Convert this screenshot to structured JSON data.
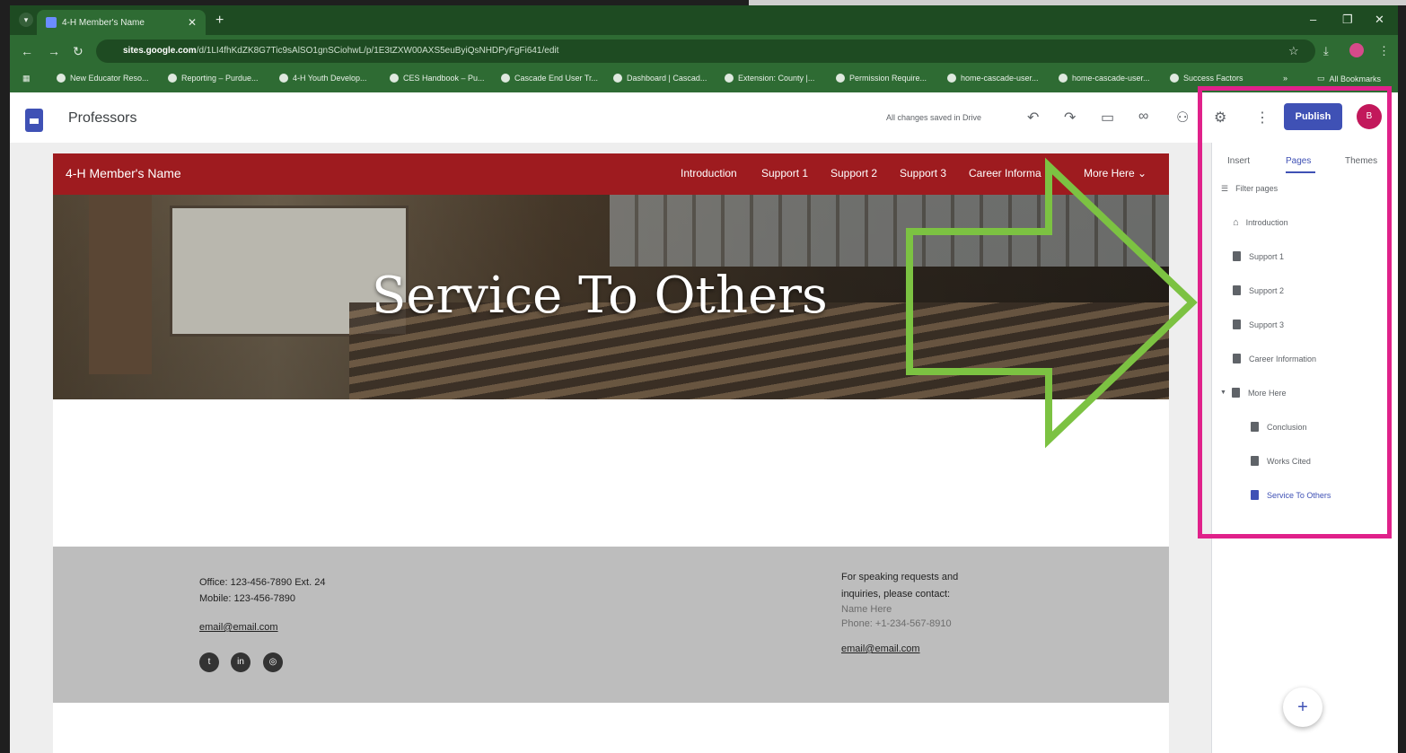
{
  "browser": {
    "tab_title": "4-H Member's Name",
    "tab_close": "✕",
    "new_tab": "+",
    "url_host": "sites.google.com",
    "url_path": "/d/1LI4fhKdZK8G7Tic9sAlSO1gnSCiohwL/p/1E3tZXW00AXS5euByiQsNHDPyFgFi641/edit",
    "window_controls": [
      "–",
      "❐",
      "✕"
    ],
    "bookmarks": [
      "New Educator Reso...",
      "Reporting – Purdue...",
      "4-H Youth Develop...",
      "CES Handbook – Pu...",
      "Cascade End User Tr...",
      "Dashboard | Cascad...",
      "Extension: County |...",
      "Permission Require...",
      "home-cascade-user...",
      "home-cascade-user...",
      "Success Factors"
    ],
    "bookmarks_more": "»",
    "all_bookmarks": "All Bookmarks"
  },
  "sites": {
    "site_name": "Professors",
    "save_status": "All changes saved in Drive",
    "publish_label": "Publish",
    "avatar_initial": "B"
  },
  "page": {
    "site_title": "4-H Member's Name",
    "nav": [
      "Introduction",
      "Support 1",
      "Support 2",
      "Support 3",
      "Career Informa",
      "More Here ⌄"
    ],
    "hero_title": "Service To Others",
    "footer_left": {
      "office": "Office: 123-456-7890 Ext. 24",
      "mobile": "Mobile: 123-456-7890",
      "email": "email@email.com"
    },
    "footer_right": {
      "line1": "For speaking requests and",
      "line2": "inquiries, please contact:",
      "name": "Name Here",
      "phone": "Phone: +1-234-567-8910",
      "email": "email@email.com"
    }
  },
  "panel": {
    "tabs": [
      "Insert",
      "Pages",
      "Themes"
    ],
    "active_tab": "Pages",
    "filter_placeholder": "Filter pages",
    "pages": [
      {
        "label": "Introduction",
        "icon": "home-icon"
      },
      {
        "label": "Support 1",
        "icon": "page-icon"
      },
      {
        "label": "Support 2",
        "icon": "page-icon"
      },
      {
        "label": "Support 3",
        "icon": "page-icon"
      },
      {
        "label": "Career Information",
        "icon": "page-icon"
      },
      {
        "label": "More Here",
        "icon": "page-icon"
      },
      {
        "label": "Conclusion",
        "icon": "page-icon"
      },
      {
        "label": "Works Cited",
        "icon": "page-icon"
      },
      {
        "label": "Service To Others",
        "icon": "page-icon"
      }
    ],
    "add_button": "+"
  },
  "colors": {
    "site_header": "#9e1b1f",
    "accent": "#3f51b5",
    "highlight_box": "#e0218a",
    "arrow": "#7cc242"
  }
}
